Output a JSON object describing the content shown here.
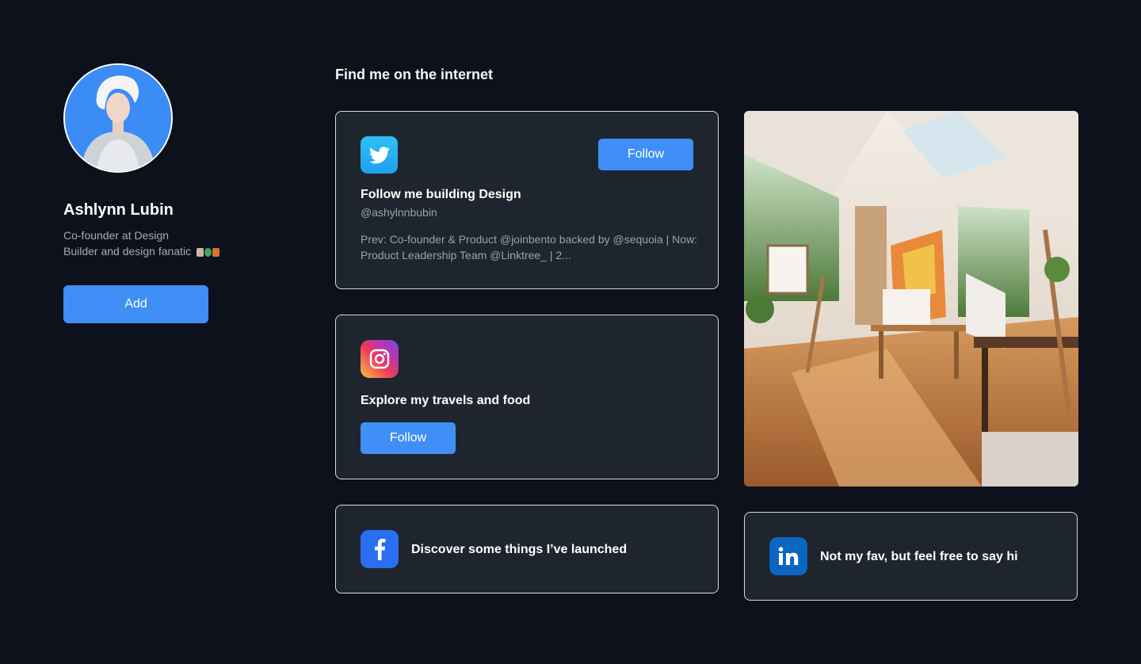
{
  "profile": {
    "name": "Ashlynn Lubin",
    "bio_line1": "Co-founder at Design",
    "bio_line2": "Builder and design fanatic",
    "add_label": "Add"
  },
  "section_title": "Find me on the internet",
  "twitter": {
    "icon": "twitter-bird",
    "color": "#1da1f2",
    "title": "Follow me building Design",
    "handle": "@ashylnnbubin",
    "description": "Prev: Co-founder & Product @joinbento backed by @sequoia | Now: Product Leadership Team @Linktree_ | 2...",
    "follow_label": "Follow"
  },
  "instagram": {
    "icon": "instagram-camera",
    "title": "Explore my travels and food",
    "follow_label": "Follow"
  },
  "facebook": {
    "icon": "facebook-f",
    "color": "#2a6ff2",
    "title": "Discover some things I’ve launched"
  },
  "linkedin": {
    "icon": "linkedin-in",
    "color": "#0b66c2",
    "title": "Not my fav, but feel free to say hi"
  },
  "colors": {
    "background": "#0d111b",
    "card": "#1f252e",
    "accent": "#3f8ff7"
  }
}
